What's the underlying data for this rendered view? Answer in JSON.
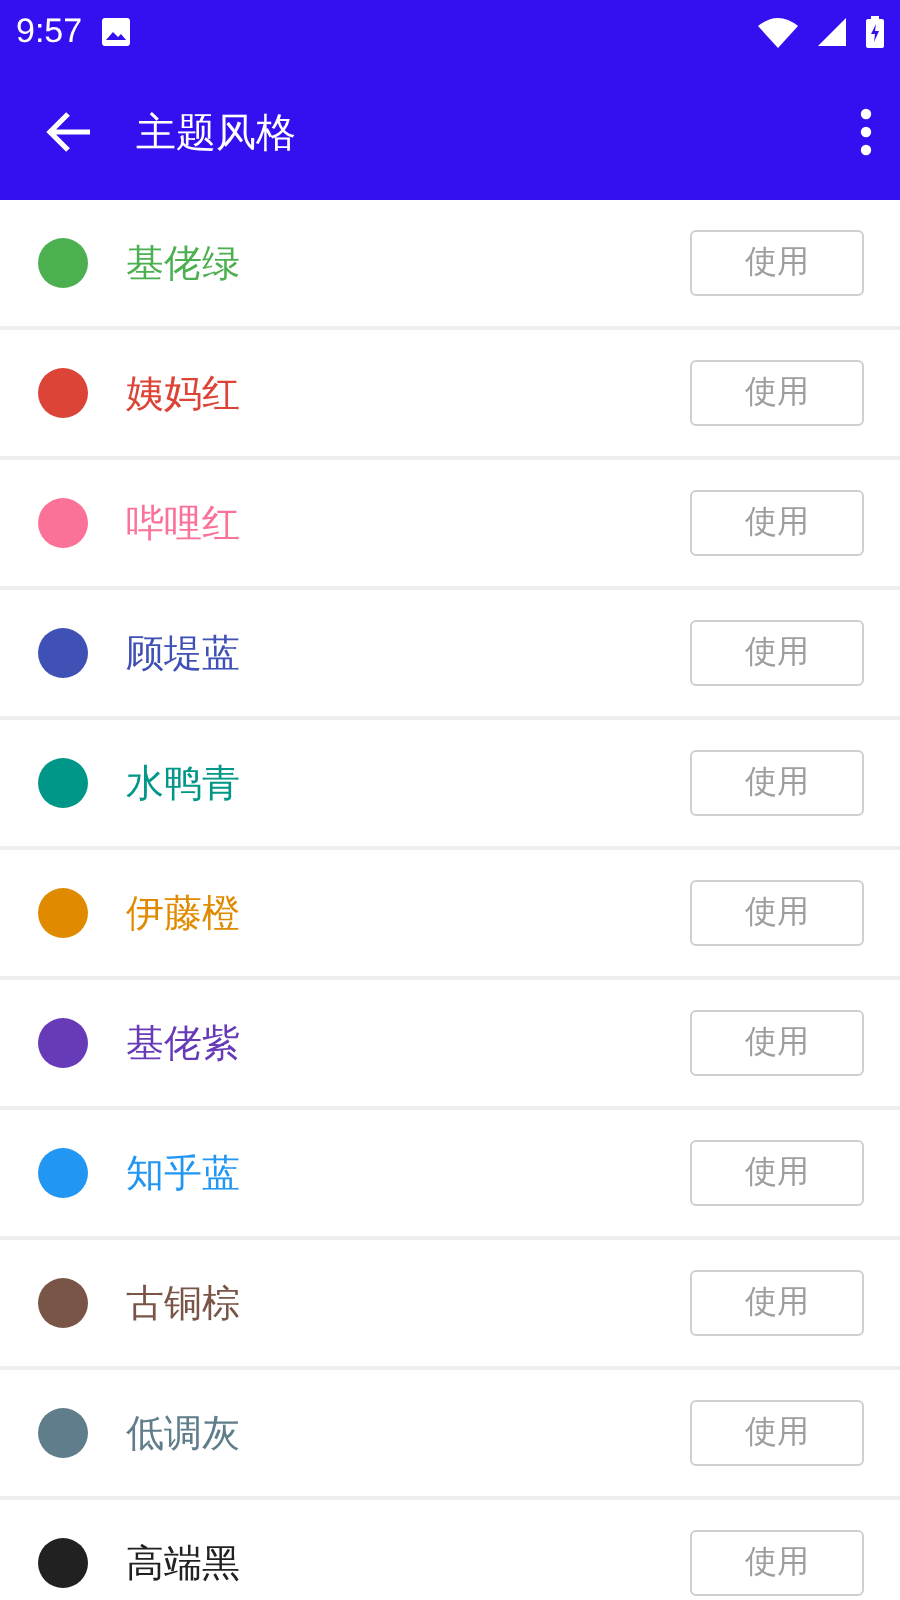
{
  "status_bar": {
    "time": "9:57"
  },
  "app_bar": {
    "title": "主题风格"
  },
  "themes": [
    {
      "name": "基佬绿",
      "color": "#4caf50",
      "button": "使用"
    },
    {
      "name": "姨妈红",
      "color": "#db4437",
      "button": "使用"
    },
    {
      "name": "哔哩红",
      "color": "#fb7299",
      "button": "使用"
    },
    {
      "name": "顾堤蓝",
      "color": "#3f51b5",
      "button": "使用"
    },
    {
      "name": "水鸭青",
      "color": "#009688",
      "button": "使用"
    },
    {
      "name": "伊藤橙",
      "color": "#e08a00",
      "button": "使用"
    },
    {
      "name": "基佬紫",
      "color": "#673ab7",
      "button": "使用"
    },
    {
      "name": "知乎蓝",
      "color": "#2196f3",
      "button": "使用"
    },
    {
      "name": "古铜棕",
      "color": "#795548",
      "button": "使用"
    },
    {
      "name": "低调灰",
      "color": "#607d8b",
      "button": "使用"
    },
    {
      "name": "高端黑",
      "color": "#212121",
      "button": "使用"
    }
  ]
}
